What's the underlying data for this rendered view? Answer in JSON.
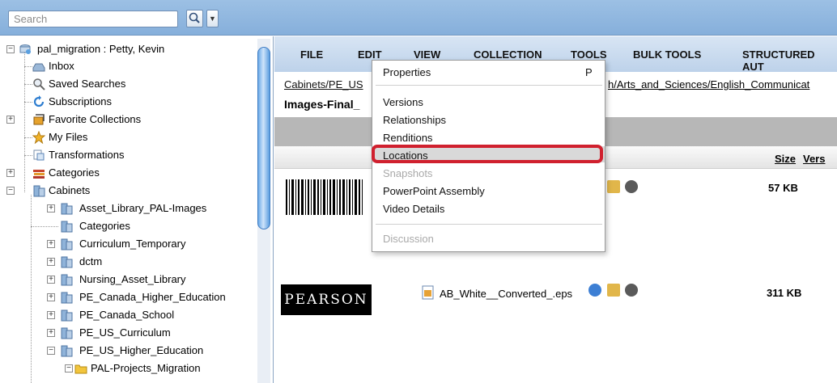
{
  "search": {
    "placeholder": "Search"
  },
  "tree": {
    "root": "pal_migration : Petty, Kevin",
    "items": [
      "Inbox",
      "Saved Searches",
      "Subscriptions",
      "Favorite Collections",
      "My Files",
      "Transformations",
      "Categories",
      "Cabinets"
    ],
    "cabinets": [
      "Asset_Library_PAL-Images",
      "Categories",
      "Curriculum_Temporary",
      "dctm",
      "Nursing_Asset_Library",
      "PE_Canada_Higher_Education",
      "PE_Canada_School",
      "PE_US_Curriculum",
      "PE_US_Higher_Education"
    ],
    "sub": "PAL-Projects_Migration"
  },
  "menubar": [
    "FILE",
    "EDIT",
    "VIEW",
    "COLLECTION",
    "TOOLS",
    "BULK TOOLS",
    "STRUCTURED AUT"
  ],
  "breadcrumb": {
    "left": "Cabinets/PE_US",
    "right": "h/Arts_and_Sciences/English_Communicat"
  },
  "folder_title": "Images-Final_",
  "columns": {
    "size": "Size",
    "version": "Vers"
  },
  "rows": [
    {
      "name": "",
      "size": "57 KB"
    },
    {
      "name": "AB_White__Converted_.eps",
      "size": "311 KB"
    }
  ],
  "thumbnails": {
    "pearson_logo": "PEARSON"
  },
  "view_menu": {
    "items": [
      {
        "label": "Properties",
        "shortcut": "P",
        "enabled": true
      },
      {
        "label": "Versions",
        "enabled": true
      },
      {
        "label": "Relationships",
        "enabled": true
      },
      {
        "label": "Renditions",
        "enabled": true
      },
      {
        "label": "Locations",
        "enabled": true,
        "highlighted": true
      },
      {
        "label": "Snapshots",
        "enabled": false
      },
      {
        "label": "PowerPoint Assembly",
        "enabled": true
      },
      {
        "label": "Video Details",
        "enabled": true
      },
      {
        "label": "Discussion",
        "enabled": false
      }
    ]
  },
  "colors": {
    "highlight_outline": "#d0202e",
    "header_blue": "#9cc0e4"
  }
}
